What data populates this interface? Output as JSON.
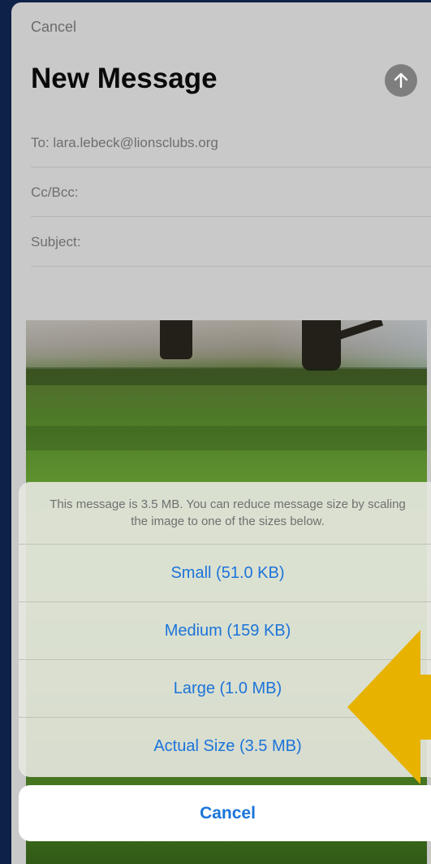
{
  "compose": {
    "cancel_label": "Cancel",
    "title": "New Message",
    "to_field": "To: lara.lebeck@lionsclubs.org",
    "cc_field": "Cc/Bcc:",
    "subject_field": "Subject:"
  },
  "resize_sheet": {
    "message": "This message is 3.5 MB. You can reduce message size by scaling the image to one of the sizes below.",
    "options": [
      {
        "label": "Small (51.0 KB)"
      },
      {
        "label": "Medium (159 KB)"
      },
      {
        "label": "Large (1.0 MB)"
      },
      {
        "label": "Actual Size (3.5 MB)"
      }
    ],
    "cancel_label": "Cancel"
  },
  "colors": {
    "accent": "#1c74d9",
    "annotation_arrow": "#e8b200",
    "background": "#0e2147"
  }
}
